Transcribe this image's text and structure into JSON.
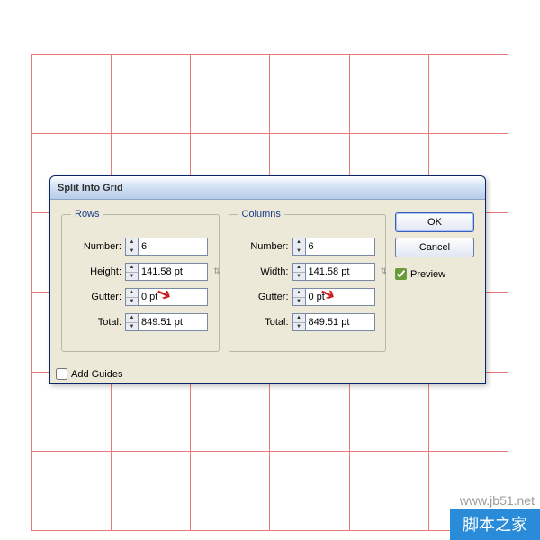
{
  "dialog": {
    "title": "Split Into Grid",
    "rows_legend": "Rows",
    "cols_legend": "Columns",
    "labels": {
      "number": "Number:",
      "height": "Height:",
      "width": "Width:",
      "gutter": "Gutter:",
      "total": "Total:"
    },
    "rows": {
      "number": "6",
      "height": "141.58 pt",
      "gutter": "0 pt",
      "total": "849.51 pt"
    },
    "cols": {
      "number": "6",
      "width": "141.58 pt",
      "gutter": "0 pt",
      "total": "849.51 pt"
    },
    "add_guides": "Add Guides",
    "ok": "OK",
    "cancel": "Cancel",
    "preview": "Preview"
  },
  "watermark": {
    "url": "www.jb51.net",
    "text": "脚本之家"
  }
}
